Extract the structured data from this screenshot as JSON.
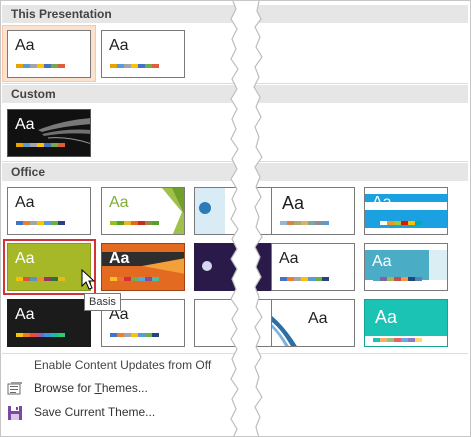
{
  "sections": {
    "this_presentation": "This Presentation",
    "custom": "Custom",
    "office": "Office"
  },
  "theme_glyph": "Aa",
  "tooltip": "Basis",
  "commands": {
    "enable_updates": "Enable Content Updates from Off",
    "browse_prefix": "Browse for ",
    "browse_ul": "T",
    "browse_suffix": "hemes...",
    "save_prefix": "Save Current Theme..."
  },
  "icons": {
    "browse": "folder-browse-icon",
    "save": "save-icon",
    "cursor": "mouse-pointer-icon"
  },
  "colors": {
    "header_bg": "#e6e6e6",
    "selection_red": "#d13438",
    "hover_peach": "#f7c9a8",
    "basis_green": "#a6b727",
    "palette": [
      "#e8a202",
      "#5b9bd5",
      "#a5a5a5",
      "#ffc000",
      "#4472c4",
      "#70ad47",
      "#e25d3a"
    ]
  }
}
